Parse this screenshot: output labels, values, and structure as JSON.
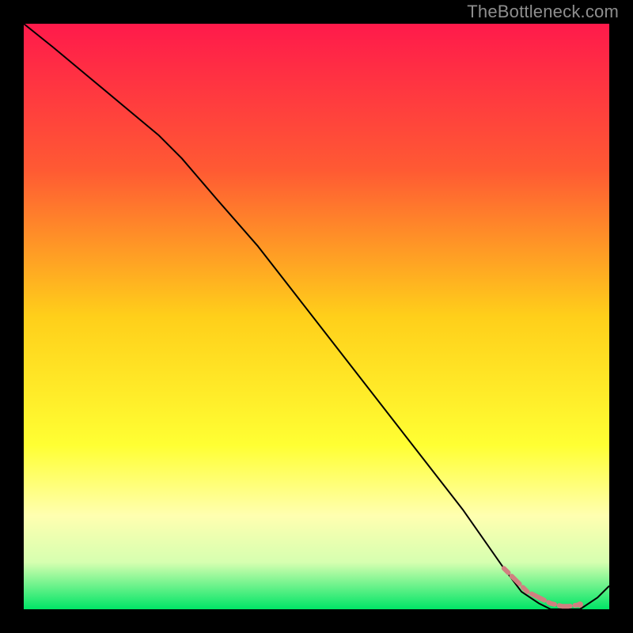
{
  "watermark": "TheBottleneck.com",
  "chart_data": {
    "type": "line",
    "title": "",
    "xlabel": "",
    "ylabel": "",
    "xlim": [
      0,
      100
    ],
    "ylim": [
      0,
      100
    ],
    "grid": false,
    "legend": false,
    "gradient_stops": [
      {
        "offset": 0.0,
        "color": "#ff1a4b"
      },
      {
        "offset": 0.25,
        "color": "#ff5a33"
      },
      {
        "offset": 0.5,
        "color": "#ffcf1a"
      },
      {
        "offset": 0.72,
        "color": "#ffff33"
      },
      {
        "offset": 0.84,
        "color": "#ffffb0"
      },
      {
        "offset": 0.92,
        "color": "#d6ffb0"
      },
      {
        "offset": 1.0,
        "color": "#00e566"
      }
    ],
    "series": [
      {
        "name": "bottleneck-curve",
        "color": "#000000",
        "width": 2,
        "x": [
          0,
          5,
          11,
          17,
          23,
          27,
          33,
          40,
          47,
          54,
          61,
          68,
          75,
          82,
          85,
          88,
          90,
          93,
          95,
          98,
          100
        ],
        "y": [
          100,
          96,
          91,
          86,
          81,
          77,
          70,
          62,
          53,
          44,
          35,
          26,
          17,
          7,
          3,
          1,
          0,
          0,
          0,
          2,
          4
        ]
      },
      {
        "name": "optimal-range-marker",
        "color": "#d08080",
        "marker": "dot",
        "width": 6,
        "x": [
          82,
          84,
          86,
          88,
          90,
          92,
          93,
          95
        ],
        "y": [
          7,
          5,
          3,
          2,
          1,
          0.5,
          0.5,
          0.8
        ]
      }
    ]
  }
}
